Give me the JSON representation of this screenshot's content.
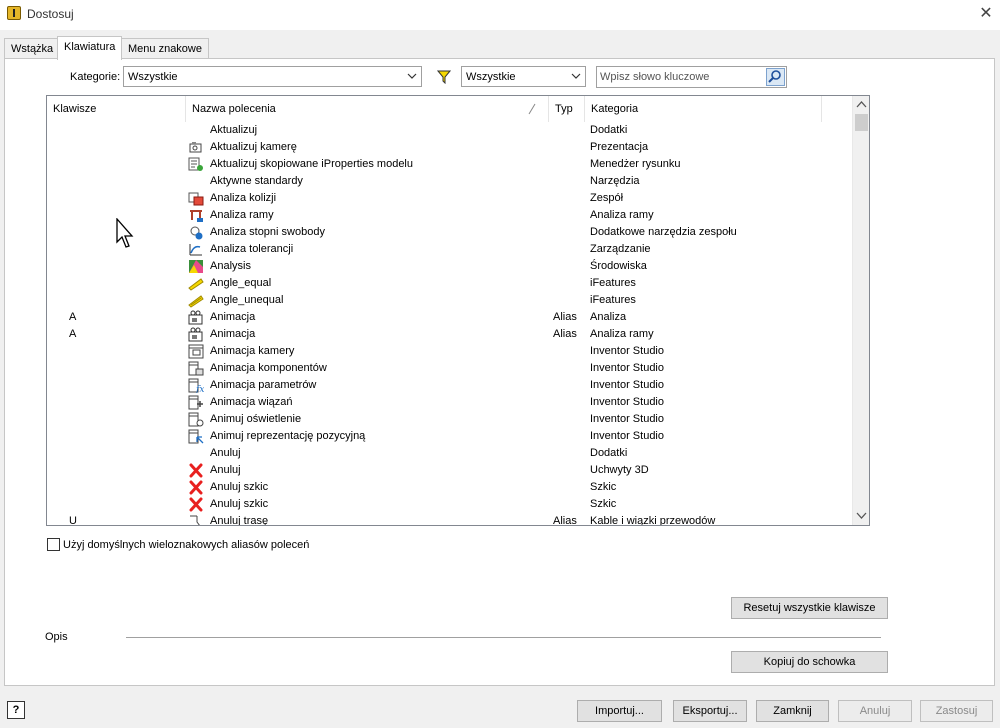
{
  "window": {
    "title": "Dostosuj"
  },
  "tabs": [
    "Wstążka",
    "Klawiatura",
    "Menu znakowe"
  ],
  "active_tab": "Klawiatura",
  "filters": {
    "category_label": "Kategorie:",
    "category_value": "Wszystkie",
    "filter_value": "Wszystkie",
    "search_placeholder": "Wpisz słowo kluczowe"
  },
  "grid": {
    "columns": [
      "Klawisze",
      "Nazwa polecenia",
      "Typ",
      "Kategoria"
    ],
    "rows": [
      {
        "key": "",
        "icon": "none",
        "name": "Aktualizuj",
        "type": "",
        "category": "Dodatki"
      },
      {
        "key": "",
        "icon": "camera-refresh-icon",
        "name": "Aktualizuj kamerę",
        "type": "",
        "category": "Prezentacja"
      },
      {
        "key": "",
        "icon": "iproperties-refresh-icon",
        "name": "Aktualizuj skopiowane iProperties modelu",
        "type": "",
        "category": "Menedżer rysunku"
      },
      {
        "key": "",
        "icon": "none",
        "name": "Aktywne standardy",
        "type": "",
        "category": "Narzędzia"
      },
      {
        "key": "",
        "icon": "interference-icon",
        "name": "Analiza kolizji",
        "type": "",
        "category": "Zespół"
      },
      {
        "key": "",
        "icon": "frame-analysis-icon",
        "name": "Analiza ramy",
        "type": "",
        "category": "Analiza ramy"
      },
      {
        "key": "",
        "icon": "dof-analysis-icon",
        "name": "Analiza stopni swobody",
        "type": "",
        "category": "Dodatkowe narzędzia zespołu"
      },
      {
        "key": "",
        "icon": "tolerance-analysis-icon",
        "name": "Analiza tolerancji",
        "type": "",
        "category": "Zarządzanie"
      },
      {
        "key": "",
        "icon": "analysis-icon",
        "name": "Analysis",
        "type": "",
        "category": "Środowiska"
      },
      {
        "key": "",
        "icon": "angle-equal-icon",
        "name": "Angle_equal",
        "type": "",
        "category": "iFeatures"
      },
      {
        "key": "",
        "icon": "angle-unequal-icon",
        "name": "Angle_unequal",
        "type": "",
        "category": "iFeatures"
      },
      {
        "key": "A",
        "icon": "animation-icon",
        "name": "Animacja",
        "type": "Alias",
        "category": "Analiza"
      },
      {
        "key": "A",
        "icon": "animation-icon",
        "name": "Animacja",
        "type": "Alias",
        "category": "Analiza ramy"
      },
      {
        "key": "",
        "icon": "animate-camera-icon",
        "name": "Animacja kamery",
        "type": "",
        "category": "Inventor Studio"
      },
      {
        "key": "",
        "icon": "animate-components-icon",
        "name": "Animacja komponentów",
        "type": "",
        "category": "Inventor Studio"
      },
      {
        "key": "",
        "icon": "animate-parameters-icon",
        "name": "Animacja parametrów",
        "type": "",
        "category": "Inventor Studio"
      },
      {
        "key": "",
        "icon": "animate-constraints-icon",
        "name": "Animacja wiązań",
        "type": "",
        "category": "Inventor Studio"
      },
      {
        "key": "",
        "icon": "animate-lighting-icon",
        "name": "Animuj oświetlenie",
        "type": "",
        "category": "Inventor Studio"
      },
      {
        "key": "",
        "icon": "animate-positional-icon",
        "name": "Animuj reprezentację pozycyjną",
        "type": "",
        "category": "Inventor Studio"
      },
      {
        "key": "",
        "icon": "none",
        "name": "Anuluj",
        "type": "",
        "category": "Dodatki"
      },
      {
        "key": "",
        "icon": "cancel-icon",
        "name": "Anuluj",
        "type": "",
        "category": "Uchwyty 3D"
      },
      {
        "key": "",
        "icon": "cancel-icon",
        "name": "Anuluj szkic",
        "type": "",
        "category": "Szkic"
      },
      {
        "key": "",
        "icon": "cancel-icon",
        "name": "Anuluj szkic",
        "type": "",
        "category": "Szkic"
      },
      {
        "key": "U",
        "icon": "cancel-route-icon",
        "name": "Anuluj trasę",
        "type": "Alias",
        "category": "Kable i wiązki przewodów"
      }
    ]
  },
  "checkbox": {
    "label": "Użyj domyślnych wieloznakowych aliasów poleceń",
    "checked": false
  },
  "buttons": {
    "reset_all": "Resetuj wszystkie klawisze",
    "copy": "Kopiuj do schowka",
    "import": "Importuj...",
    "export": "Eksportuj...",
    "close": "Zamknij",
    "cancel": "Anuluj",
    "apply": "Zastosuj"
  },
  "description_label": "Opis",
  "help_label": "?",
  "colors": {
    "cancel_red": "#e8201f",
    "accent_blue": "#1f6fc5",
    "filter_yellow": "#f5d800"
  }
}
